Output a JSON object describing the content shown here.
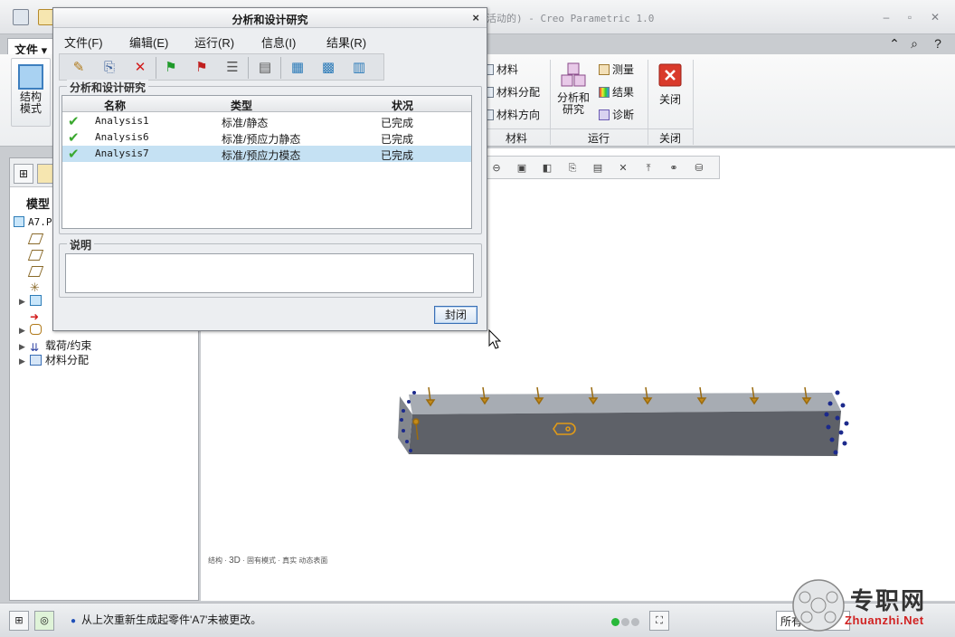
{
  "main_window": {
    "title": "活动的) - Creo Parametric 1.0",
    "window_controls": [
      "–",
      "▫",
      "✕"
    ],
    "file_tab": "文件 ▾",
    "header_icons": [
      "up-chevron-icon",
      "search-icon",
      "help-icon"
    ]
  },
  "ribbon": {
    "struct_mode": {
      "line1": "结构",
      "line2": "模式"
    },
    "material": {
      "material": "材料",
      "material_assign": "材料分配",
      "material_direction": "材料方向",
      "group": "材料"
    },
    "run": {
      "analysis_line1": "分析和",
      "analysis_line2": "研究",
      "measure": "测量",
      "results": "结果",
      "diagnose": "诊断",
      "group": "运行"
    },
    "close": {
      "label": "关闭",
      "group": "关闭"
    }
  },
  "model_tree": {
    "title": "模型",
    "root": "A7.P",
    "items": {
      "loads": "载荷/约束",
      "material_assign": "材料分配"
    }
  },
  "view_info": {
    "a": "结构",
    "b": "3D",
    "c": "固有模式",
    "d": "真实",
    "e": "动态表面"
  },
  "status": {
    "message": "从上次重新生成起零件'A7'未被更改。",
    "filter": "所有"
  },
  "watermark": {
    "cn": "专职网",
    "en": "Zhuanzhi.Net"
  },
  "dialog": {
    "title": "分析和设计研究",
    "close_symbol": "×",
    "menu": [
      "文件(F)",
      "编辑(E)",
      "运行(R)",
      "信息(I)",
      "结果(R)"
    ],
    "studies_label": "分析和设计研究",
    "columns": {
      "name": "名称",
      "type": "类型",
      "status": "状况"
    },
    "rows": [
      {
        "name": "Analysis1",
        "type": "标准/静态",
        "status": "已完成"
      },
      {
        "name": "Analysis6",
        "type": "标准/预应力静态",
        "status": "已完成"
      },
      {
        "name": "Analysis7",
        "type": "标准/预应力模态",
        "status": "已完成"
      }
    ],
    "description_label": "说明",
    "close_button": "封闭"
  }
}
